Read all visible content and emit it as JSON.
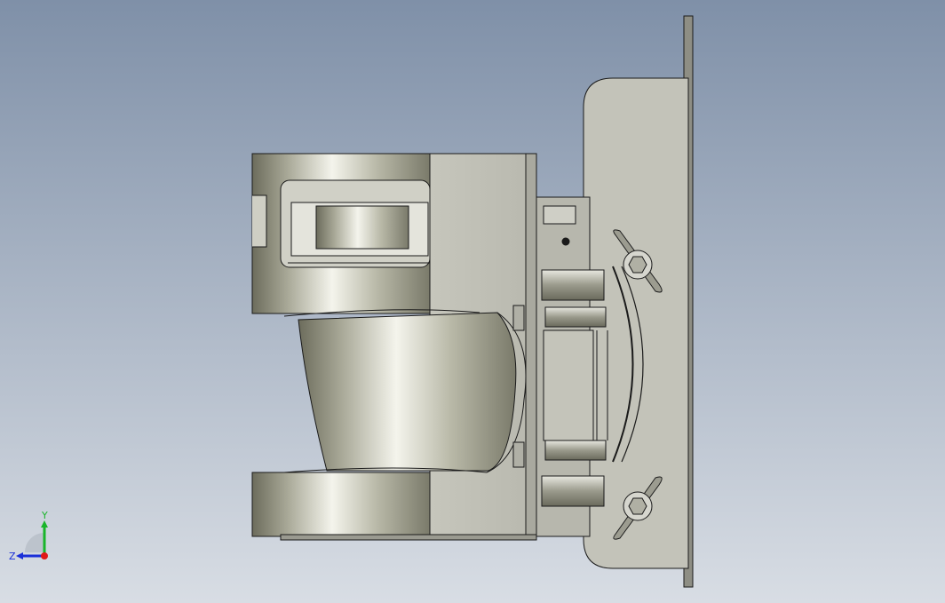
{
  "view": {
    "background_top": "#7f90a8",
    "background_bottom": "#d8dde4"
  },
  "model": {
    "edge_color": "#1a1a1a",
    "body_color": "#c8c8c0",
    "metal_highlight": "#f4f4ec",
    "metal_shadow": "#6c6c5c"
  },
  "triad": {
    "y_label": "Y",
    "z_label": "Z",
    "y_color": "#19b52a",
    "z_color": "#1a2fd8",
    "x_color": "#e01818"
  }
}
